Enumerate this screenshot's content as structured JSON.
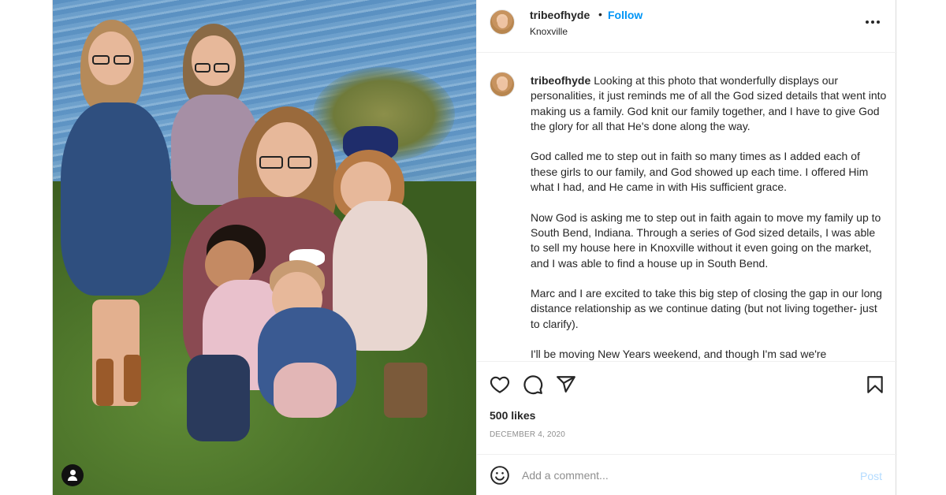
{
  "post": {
    "author": {
      "username": "tribeofhyde",
      "location": "Knoxville"
    },
    "header": {
      "separator": "•",
      "follow_label": "Follow"
    },
    "caption": {
      "username": "tribeofhyde",
      "paragraphs": [
        "Looking at this photo that wonderfully displays our personalities, it just reminds me of all the God sized details that went into making us a family. God knit our family together, and I have to give God the glory for all that He's done along the way.",
        "God called me to step out in faith so many times as I added each of these girls to our family, and God showed up each time. I offered Him what I had, and He came in with His sufficient grace.",
        "Now God is asking me to step out in faith again to move my family up to South Bend, Indiana. Through a series of God sized details, I was able to sell my house here in Knoxville without it even going on the market, and I was able to find a house up in South Bend.",
        "Marc and I are excited to take this big step of closing the gap in our long distance relationship as we continue dating (but not living together- just to clarify).",
        "I'll be moving New Years weekend, and though I'm sad we're"
      ]
    },
    "likes": "500 likes",
    "date": "DECEMBER 4, 2020",
    "comment": {
      "placeholder": "Add a comment...",
      "post_label": "Post"
    },
    "icons": {
      "more": "more-options-icon",
      "like": "heart-icon",
      "comment": "comment-icon",
      "share": "share-icon",
      "save": "bookmark-icon",
      "emoji": "emoji-icon",
      "tag": "user-tag-icon"
    },
    "colors": {
      "follow": "#0095f6",
      "post_disabled": "#b3dbff",
      "secondary_text": "#8e8e8e"
    }
  }
}
